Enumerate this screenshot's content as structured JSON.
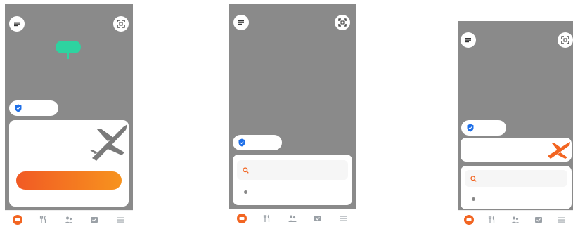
{
  "colors": {
    "map": "#8a8a8a",
    "accent": "#f26522",
    "shield": "#1e6fe8",
    "marker": "#2ed3a0",
    "nav_icon": "#9aa0a6"
  },
  "icons": {
    "menu": "menu-icon",
    "scan": "scan-icon",
    "shield": "shield-icon",
    "search": "search-icon",
    "dot": "location-dot-icon",
    "nav": [
      "car-icon",
      "food-icon",
      "people-icon",
      "ticket-icon",
      "more-icon"
    ]
  }
}
